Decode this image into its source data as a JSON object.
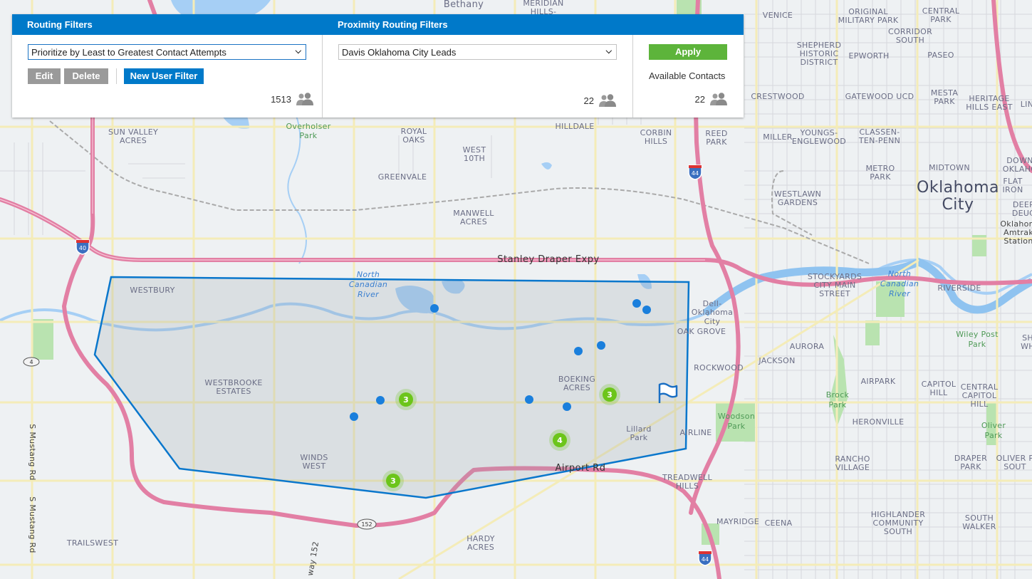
{
  "routing_filters": {
    "title": "Routing Filters",
    "selected_filter": "Prioritize by Least to Greatest Contact Attempts",
    "edit_label": "Edit",
    "delete_label": "Delete",
    "new_filter_label": "New User Filter",
    "count": "1513",
    "count_icon": "people-icon"
  },
  "proximity_filters": {
    "title": "Proximity Routing Filters",
    "selected_filter": "Davis Oklahoma City Leads",
    "count": "22",
    "count_icon": "people-icon"
  },
  "apply_panel": {
    "apply_label": "Apply",
    "available_label": "Available Contacts",
    "count": "22"
  },
  "map": {
    "colors": {
      "polygon_stroke": "#0a77cc",
      "marker_blue": "#1a7fdc",
      "cluster_green": "#6cc51a",
      "highway": "#e07aa0",
      "water": "#a6cff5"
    },
    "clusters": [
      {
        "label": "3"
      },
      {
        "label": "3"
      },
      {
        "label": "4"
      },
      {
        "label": "3"
      }
    ],
    "place_labels": {
      "bethany": "Bethany",
      "meridian": "MERIDIAN",
      "hills": "HILLS-",
      "venice": "VENICE",
      "original1": "ORIGINAL",
      "original2": "MILITARY PARK",
      "central1": "CENTRAL",
      "central2": "PARK",
      "corridor1": "CORRIDOR",
      "corridor2": "SOUTH",
      "shepherd1": "SHEPHERD",
      "shepherd2": "HISTORIC",
      "shepherd3": "DISTRICT",
      "epworth": "EPWORTH",
      "paseo": "PASEO",
      "crestwood": "CRESTWOOD",
      "gatewood": "GATEWOOD UCD",
      "mesta1": "MESTA",
      "mesta2": "PARK",
      "heritage1": "HERITAGE",
      "heritage2": "HILLS EAST",
      "lin": "LIN",
      "miller": "MILLER",
      "youngs1": "YOUNGS-",
      "youngs2": "ENGLEWOOD",
      "classen1": "CLASSEN-",
      "classen2": "TEN-PENN",
      "sunvalley1": "SUN VALLEY",
      "sunvalley2": "ACRES",
      "overholser1": "Overholser",
      "overholser2": "Park",
      "royal1": "ROYAL",
      "royal2": "OAKS",
      "west10_1": "WEST",
      "west10_2": "10TH",
      "hilldale": "HILLDALE",
      "corbin1": "CORBIN",
      "corbin2": "HILLS",
      "reed1": "REED",
      "reed2": "PARK",
      "greenvale": "GREENVALE",
      "metro1": "METRO",
      "metro2": "PARK",
      "midtown": "MIDTOWN",
      "down1": "DOWN",
      "down2": "OKLAHO",
      "flat1": "FLAT",
      "flat2": "IRON",
      "westlawn1": "WESTLAWN",
      "westlawn2": "GARDENS",
      "okc1": "Oklahoma",
      "okc2": "City",
      "deep1": "DEEP",
      "deep2": "DEUC",
      "amtrak1": "Oklahom",
      "amtrak2": "Amtrak",
      "amtrak3": "Station",
      "manwell1": "MANWELL",
      "manwell2": "ACRES",
      "stanley": "Stanley  Draper  Expy",
      "westbury": "WESTBURY",
      "ncr1": "North",
      "ncr2": "Canadian",
      "ncr3": "River",
      "stockyards1": "STOCKYARDS",
      "stockyards2": "CITY MAIN",
      "stockyards3": "STREET",
      "ncr4": "North",
      "ncr5": "Canadian",
      "ncr6": "River",
      "riverside": "RIVERSIDE",
      "dell1": "Dell-",
      "dell2": "Oklahoma",
      "dell3": "City",
      "oakgrove": "OAK GROVE",
      "wiley1": "Wiley Post",
      "wiley2": "Park",
      "sh1": "SH",
      "sh2": "WH",
      "aurora": "AURORA",
      "jackson": "JACKSON",
      "rockwood": "ROCKWOOD",
      "westbrooke1": "WESTBROOKE",
      "westbrooke2": "ESTATES",
      "boeking1": "BOEKING",
      "boeking2": "ACRES",
      "airpark": "AIRPARK",
      "capitol1": "CAPITOL",
      "capitol2": "HILL",
      "ccapitol1": "CENTRAL",
      "ccapitol2": "CAPITOL",
      "ccapitol3": "HILL",
      "brock1": "Brock",
      "brock2": "Park",
      "woodson1": "Woodson",
      "woodson2": "Park",
      "heronville": "HERONVILLE",
      "oliver1": "Oliver",
      "oliver2": "Park",
      "lillard1": "Lillard",
      "lillard2": "Park",
      "airline": "AIRLINE",
      "winds1": "WINDS",
      "winds2": "WEST",
      "airport": "Airport  Rd",
      "treadwell1": "TREADWELL",
      "treadwell2": "HILLS",
      "rancho1": "RANCHO",
      "rancho2": "VILLAGE",
      "draper1": "DRAPER",
      "draper2": "PARK",
      "oliverps1": "OLIVER P",
      "oliverps2": "SOUT",
      "mayridge": "MAYRIDGE",
      "ceena": "CEENA",
      "highlander1": "HIGHLANDER",
      "highlander2": "COMMUNITY",
      "highlander3": "SOUTH",
      "southwalker1": "SOUTH",
      "southwalker2": "WALKER",
      "trailswest": "TRAILSWEST",
      "hardy1": "HARDY",
      "hardy2": "ACRES",
      "mustang1": "S Mustang Rd",
      "mustang2": "S Mustang Rd",
      "hw152": "way 152",
      "shield40": "40",
      "shield44a": "44",
      "shield44b": "44",
      "shield4": "4",
      "shield152": "152"
    }
  }
}
